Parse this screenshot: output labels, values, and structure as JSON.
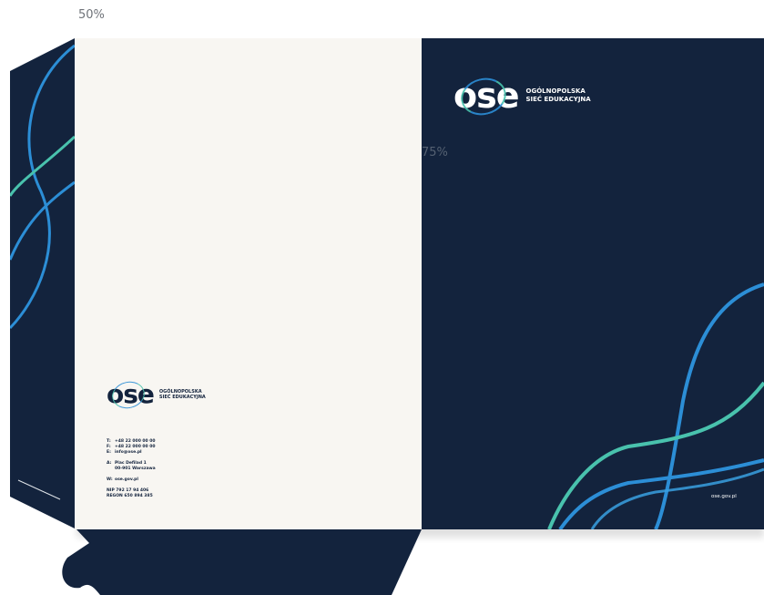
{
  "zoom": {
    "label_top": "50%",
    "label_mid": "75%"
  },
  "colors": {
    "navy": "#13233d",
    "paper": "#f8f6f2",
    "teal": "#49c2ad",
    "blue": "#2c8ed6"
  },
  "brand": {
    "mark": "ose",
    "line1": "OGÓLNOPOLSKA",
    "line2": "SIEĆ EDUKACYJNA"
  },
  "contact": {
    "phone": {
      "key": "T:",
      "value": "+48 22 000 00 00"
    },
    "fax": {
      "key": "F:",
      "value": "+48 22 000 00 00"
    },
    "email": {
      "key": "E:",
      "value": "info@ose.pl"
    },
    "address_key": "A:",
    "address_line1": "Plac Defilad 1",
    "address_line2": "00-901 Warszawa",
    "web_key": "W:",
    "web_value": "ose.gov.pl",
    "nip": "NIP 792 17 94 406",
    "regon": "REGON 650 894 385"
  },
  "website": "ose.gov.pl"
}
